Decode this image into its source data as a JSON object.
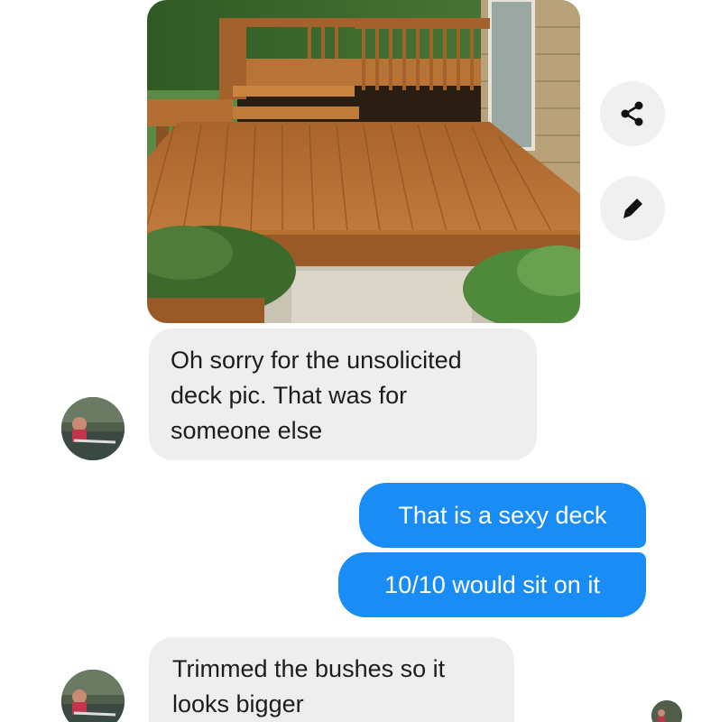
{
  "conversation": {
    "shared_photo": {
      "subject": "wooden deck photo"
    },
    "actions": {
      "share_icon": "share-icon",
      "edit_icon": "pencil-icon"
    },
    "messages": [
      {
        "direction": "incoming",
        "lines": [
          "Oh sorry for the unsolicited",
          "deck pic. That was for",
          "someone else"
        ]
      },
      {
        "direction": "outgoing",
        "text": "That is a sexy deck"
      },
      {
        "direction": "outgoing",
        "text": "10/10 would sit on it"
      },
      {
        "direction": "incoming",
        "lines": [
          "Trimmed the bushes so it",
          "looks bigger"
        ]
      }
    ]
  },
  "colors": {
    "incoming_bubble": "#eeeeef",
    "outgoing_bubble": "#1a8cf6",
    "fab_background": "#f0f0f0"
  }
}
